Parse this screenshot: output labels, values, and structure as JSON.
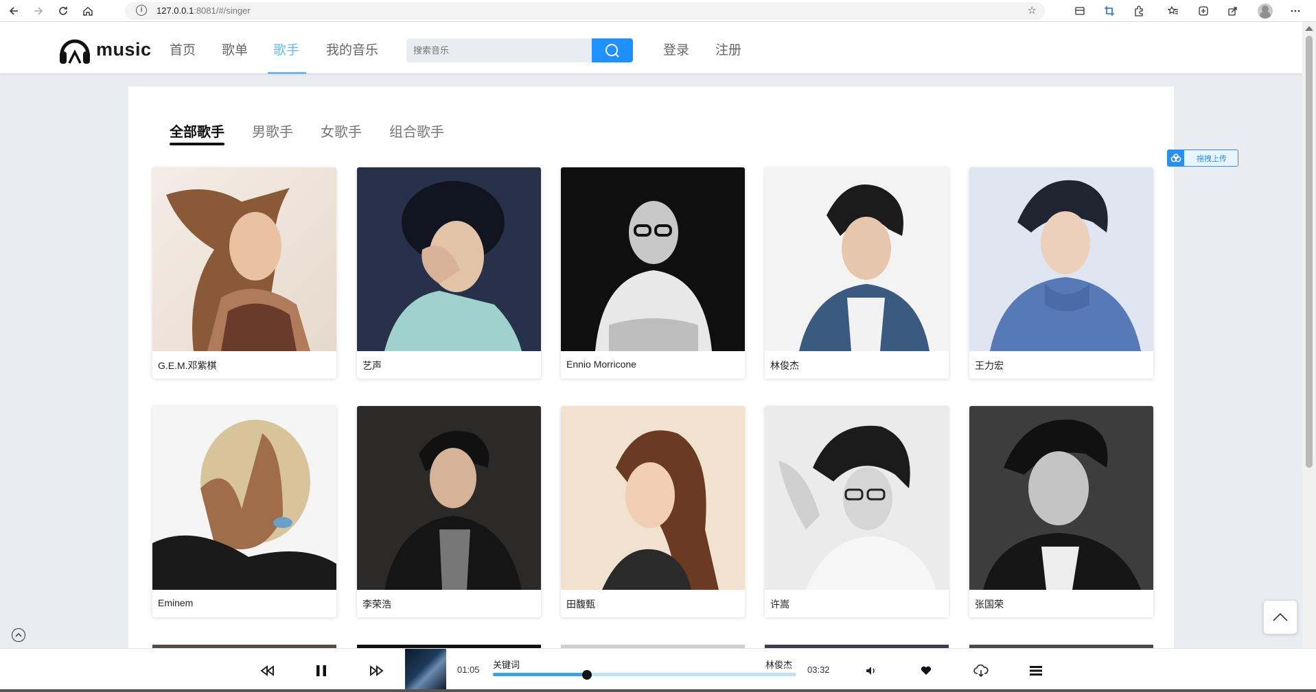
{
  "browser": {
    "url_prefix": "127.0.0.1",
    "url_suffix": ":8081/#/singer"
  },
  "header": {
    "logo_text": "music",
    "nav": {
      "home": "首页",
      "playlists": "歌单",
      "singers": "歌手",
      "my_music": "我的音乐",
      "login": "登录",
      "register": "注册"
    },
    "search_placeholder": "搜索音乐",
    "active_nav": "歌手"
  },
  "tabs": {
    "all": "全部歌手",
    "male": "男歌手",
    "female": "女歌手",
    "group": "组合歌手",
    "active": "全部歌手"
  },
  "singers": [
    {
      "name": "G.E.M.邓紫棋"
    },
    {
      "name": "艺声"
    },
    {
      "name": "Ennio Morricone"
    },
    {
      "name": "林俊杰"
    },
    {
      "name": "王力宏"
    },
    {
      "name": "Eminem"
    },
    {
      "name": "李荣浩"
    },
    {
      "name": "田馥甄"
    },
    {
      "name": "许嵩"
    },
    {
      "name": "张国荣"
    }
  ],
  "upload_widget": {
    "label": "拖拽上传"
  },
  "player": {
    "current_time": "01:05",
    "total_time": "03:32",
    "song_title": "关键词",
    "song_artist": "林俊杰",
    "progress": 0.31
  },
  "colors": {
    "accent": "#6db8e8",
    "search_button": "#1e90ff",
    "progress": "#3aa0ea",
    "progress_track": "#bfe1f5"
  }
}
